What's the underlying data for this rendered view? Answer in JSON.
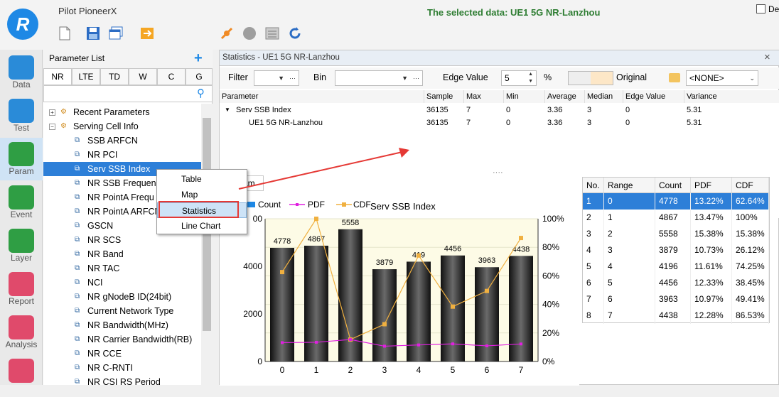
{
  "app": {
    "name": "Pilot PioneerX",
    "selected_data": "The selected data: UE1 5G NR-Lanzhou",
    "checkbox_label": "De"
  },
  "nav": [
    {
      "label": "Data",
      "icon": "data-icon",
      "color": "#2a8bd8"
    },
    {
      "label": "Test",
      "icon": "phone-icon",
      "color": "#2a8bd8"
    },
    {
      "label": "Param",
      "icon": "grid-icon",
      "color": "#2f9e44"
    },
    {
      "label": "Event",
      "icon": "list-icon",
      "color": "#2f9e44"
    },
    {
      "label": "Layer",
      "icon": "map-icon",
      "color": "#2f9e44"
    },
    {
      "label": "Report",
      "icon": "report-icon",
      "color": "#e04a6b"
    },
    {
      "label": "Analysis",
      "icon": "radar-icon",
      "color": "#e04a6b"
    },
    {
      "label": "",
      "icon": "filter-icon",
      "color": "#e04a6b"
    }
  ],
  "param_list": {
    "title": "Parameter List",
    "tabs": [
      "NR",
      "LTE",
      "TD",
      "W",
      "C",
      "G"
    ],
    "tree": [
      {
        "label": "Recent Parameters",
        "type": "group",
        "expanded": false
      },
      {
        "label": "Serving Cell Info",
        "type": "group",
        "expanded": true
      },
      {
        "label": "SSB ARFCN",
        "type": "leaf"
      },
      {
        "label": "NR PCI",
        "type": "leaf"
      },
      {
        "label": "Serv SSB Index",
        "type": "leaf",
        "selected": true
      },
      {
        "label": "NR SSB Frequen",
        "type": "leaf"
      },
      {
        "label": "NR PointA Frequ",
        "type": "leaf"
      },
      {
        "label": "NR PointA ARFCN",
        "type": "leaf"
      },
      {
        "label": "GSCN",
        "type": "leaf"
      },
      {
        "label": "NR SCS",
        "type": "leaf"
      },
      {
        "label": "NR Band",
        "type": "leaf"
      },
      {
        "label": "NR TAC",
        "type": "leaf"
      },
      {
        "label": "NCI",
        "type": "leaf"
      },
      {
        "label": "NR gNodeB ID(24bit)",
        "type": "leaf"
      },
      {
        "label": "Current Network Type",
        "type": "leaf"
      },
      {
        "label": "NR Bandwidth(MHz)",
        "type": "leaf"
      },
      {
        "label": "NR Carrier Bandwidth(RB)",
        "type": "leaf"
      },
      {
        "label": "NR CCE",
        "type": "leaf"
      },
      {
        "label": "NR C-RNTI",
        "type": "leaf"
      },
      {
        "label": "NR CSI RS Period",
        "type": "leaf"
      }
    ]
  },
  "context_menu": {
    "items": [
      "Table",
      "Map",
      "Statistics",
      "Line Chart"
    ],
    "highlighted": "Statistics"
  },
  "stats": {
    "title": "Statistics - UE1 5G NR-Lanzhou",
    "filter_label": "Filter",
    "bin_label": "Bin",
    "edge_label": "Edge Value",
    "edge_value": "5",
    "percent": "%",
    "original_label": "Original",
    "none_option": "<NONE>",
    "ellipsis": "···",
    "columns": [
      "Parameter",
      "Sample",
      "Max",
      "Min",
      "Average",
      "Median",
      "Edge Value",
      "Variance"
    ],
    "rows": [
      [
        "Serv SSB Index",
        "36135",
        "7",
        "0",
        "3.36",
        "3",
        "0",
        "5.31"
      ],
      [
        "UE1 5G NR-Lanzhou",
        "36135",
        "7",
        "0",
        "3.36",
        "3",
        "0",
        "5.31"
      ]
    ]
  },
  "graph_tab": "ram",
  "chart_data": {
    "type": "bar",
    "title": "Serv SSB Index",
    "legend": [
      "Count",
      "PDF",
      "CDF"
    ],
    "categories": [
      "0",
      "1",
      "2",
      "3",
      "4",
      "5",
      "6",
      "7"
    ],
    "series": [
      {
        "name": "Count",
        "values": [
          4778,
          4867,
          5558,
          3879,
          4196,
          4456,
          3963,
          4438
        ]
      },
      {
        "name": "PDF",
        "values": [
          13.22,
          13.47,
          15.38,
          10.73,
          11.61,
          12.33,
          10.97,
          12.28
        ]
      },
      {
        "name": "CDF",
        "values": [
          62.64,
          100,
          15.38,
          26.12,
          74.25,
          38.45,
          49.41,
          86.53
        ]
      }
    ],
    "bar_labels": [
      "4778",
      "4867",
      "5558",
      "3879",
      "419",
      "4456",
      "3963",
      "4438"
    ],
    "y_left_ticks": [
      "0",
      "2000",
      "4000",
      "00"
    ],
    "y_right_ticks": [
      "0%",
      "20%",
      "40%",
      "60%",
      "80%",
      "100%"
    ],
    "ylim": [
      0,
      6000
    ],
    "y2lim": [
      0,
      100
    ],
    "colors": {
      "count": "#222222",
      "pdf": "#e020e0",
      "cdf": "#f0b040"
    }
  },
  "bin_table": {
    "columns": [
      "No.",
      "Range",
      "Count",
      "PDF",
      "CDF"
    ],
    "rows": [
      [
        "1",
        "0",
        "4778",
        "13.22%",
        "62.64%"
      ],
      [
        "2",
        "1",
        "4867",
        "13.47%",
        "100%"
      ],
      [
        "3",
        "2",
        "5558",
        "15.38%",
        "15.38%"
      ],
      [
        "4",
        "3",
        "3879",
        "10.73%",
        "26.12%"
      ],
      [
        "5",
        "4",
        "4196",
        "11.61%",
        "74.25%"
      ],
      [
        "6",
        "5",
        "4456",
        "12.33%",
        "38.45%"
      ],
      [
        "7",
        "6",
        "3963",
        "10.97%",
        "49.41%"
      ],
      [
        "8",
        "7",
        "4438",
        "12.28%",
        "86.53%"
      ]
    ]
  }
}
